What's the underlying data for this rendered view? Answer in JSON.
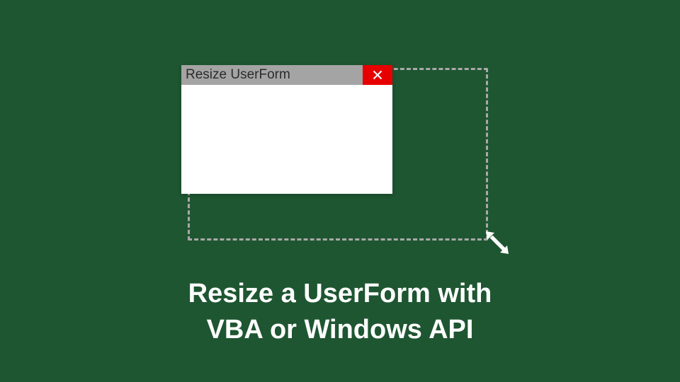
{
  "userform": {
    "title": "Resize UserForm",
    "close_label": "Close"
  },
  "caption": {
    "line1": "Resize a UserForm with",
    "line2": "VBA or Windows API"
  },
  "colors": {
    "background": "#1e5631",
    "titlebar": "#a4a4a4",
    "close": "#e60000",
    "dash": "#a9a9a9"
  }
}
